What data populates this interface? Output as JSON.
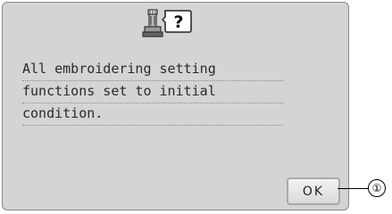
{
  "dialog": {
    "icon": "sewing-machine-question-icon",
    "question_mark": "?",
    "message_lines": [
      "All embroidering setting",
      "functions set to initial",
      "condition."
    ],
    "ok_label": "OK"
  },
  "callout": {
    "number": "①"
  },
  "colors": {
    "panel": "#d4d4d4",
    "border": "#8a8a8a",
    "text": "#2a2a2a"
  }
}
